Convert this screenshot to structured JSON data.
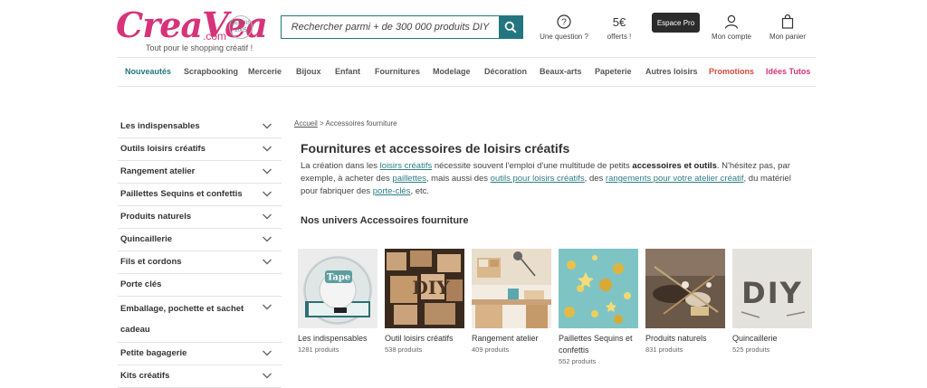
{
  "header": {
    "logo_text": "CreaVea",
    "logo_domain": ".com",
    "logo_badge": "DEPUIS 2005",
    "tagline": "Tout pour le shopping créatif !",
    "search_placeholder": "Rechercher parmi + de 300 000 produits DIY",
    "question_label": "Une question ?",
    "offers_symbol": "5€",
    "offers_label": "offerts !",
    "pro_label": "Espace Pro",
    "account_label": "Mon compte",
    "cart_label": "Mon panier"
  },
  "nav": {
    "items": [
      {
        "label": "Nouveautés",
        "color": "#23767f"
      },
      {
        "label": "Scrapbooking",
        "color": "#555555"
      },
      {
        "label": "Mercerie",
        "color": "#555555"
      },
      {
        "label": "Bijoux",
        "color": "#555555"
      },
      {
        "label": "Enfant",
        "color": "#555555"
      },
      {
        "label": "Fournitures",
        "color": "#555555"
      },
      {
        "label": "Modelage",
        "color": "#555555"
      },
      {
        "label": "Décoration",
        "color": "#555555"
      },
      {
        "label": "Beaux-arts",
        "color": "#555555"
      },
      {
        "label": "Papeterie",
        "color": "#555555"
      },
      {
        "label": "Autres loisirs",
        "color": "#555555"
      },
      {
        "label": "Promotions",
        "color": "#d64a3a"
      },
      {
        "label": "Idées Tutos",
        "color": "#d6337a"
      }
    ]
  },
  "sidebar": {
    "items": [
      {
        "label": "Les indispensables",
        "chevron": true
      },
      {
        "label": "Outils loisirs créatifs",
        "chevron": true
      },
      {
        "label": "Rangement atelier",
        "chevron": true
      },
      {
        "label": "Paillettes Sequins et confettis",
        "chevron": true
      },
      {
        "label": "Produits naturels",
        "chevron": true
      },
      {
        "label": "Quincaillerie",
        "chevron": true
      },
      {
        "label": "Fils et cordons",
        "chevron": true
      },
      {
        "label": "Porte clés",
        "chevron": false
      },
      {
        "label": "Emballage, pochette et sachet cadeau",
        "chevron": true
      },
      {
        "label": "Petite bagagerie",
        "chevron": true
      },
      {
        "label": "Kits créatifs",
        "chevron": true
      }
    ]
  },
  "breadcrumb": {
    "home": "Accueil",
    "separator": " > ",
    "current": "Accessoires fourniture"
  },
  "main": {
    "title": "Fournitures et accessoires de loisirs créatifs",
    "intro": {
      "t1": "La création dans les ",
      "l1": "loisirs créatifs",
      "t2": " nécessite souvent l'emploi d'une multitude de petits ",
      "b1": "accessoires et outils",
      "t3": ". N'hésitez pas, par exemple, à acheter des ",
      "l2": "paillettes",
      "t4": ", mais aussi des ",
      "l3": "outils pour loisirs créatifs",
      "t5": ", des ",
      "l4": "rangements pour votre atelier créatif",
      "t6": ", du matériel pour fabriquer des ",
      "l5": "porte-clés",
      "t7": ", etc."
    },
    "section_title": "Nos univers Accessoires fourniture",
    "cards": [
      {
        "name": "Les indispensables",
        "count": "1281 produits",
        "tape_text": "Tape"
      },
      {
        "name": "Outil loisirs créatifs",
        "count": "538 produits",
        "stamp_text": "DIY"
      },
      {
        "name": "Rangement atelier",
        "count": "409 produits"
      },
      {
        "name": "Paillettes Sequins et confettis",
        "count": "552 produits"
      },
      {
        "name": "Produits naturels",
        "count": "831 produits"
      },
      {
        "name": "Quincaillerie",
        "count": "525 produits",
        "nail_text": "DIY"
      }
    ]
  },
  "colors": {
    "brand_pink": "#d6337a",
    "teal": "#23767f",
    "promo_red": "#d64a3a"
  }
}
